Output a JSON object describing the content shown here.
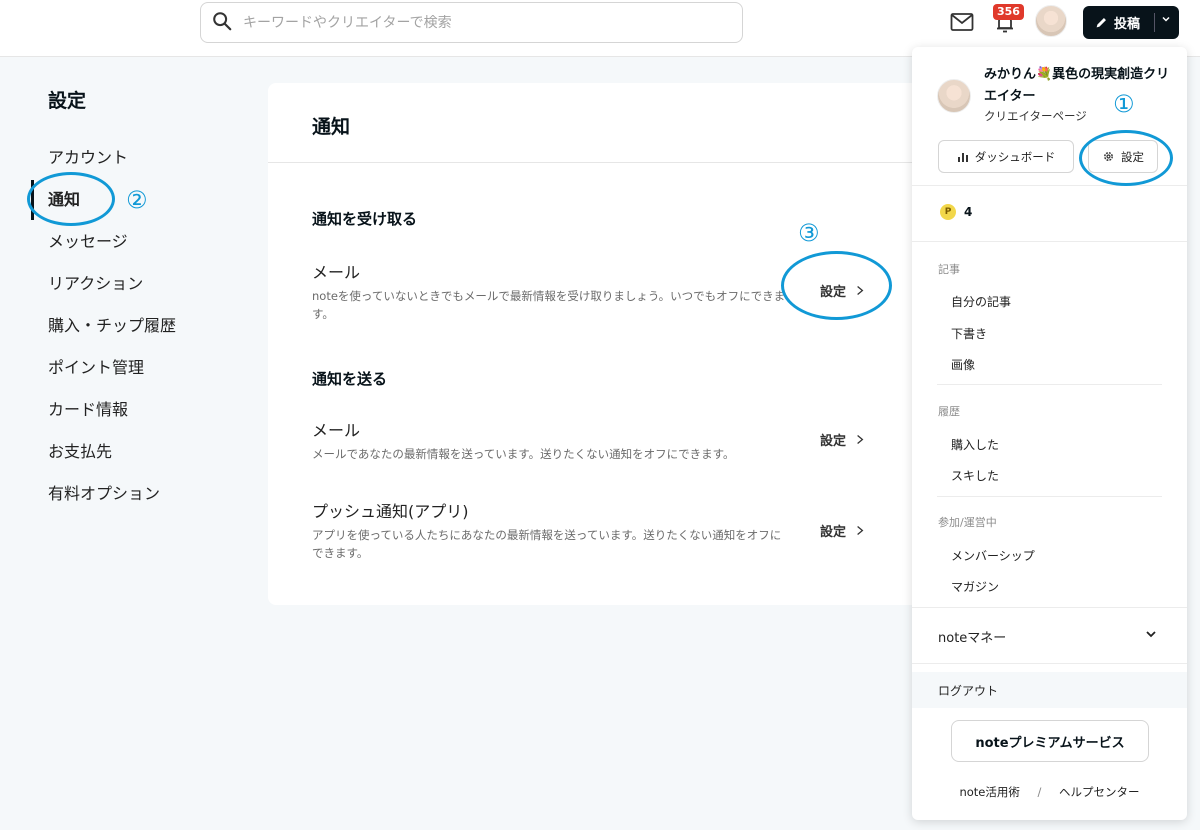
{
  "header": {
    "search_placeholder": "キーワードやクリエイターで検索",
    "notification_count": "356",
    "post_label": "投稿"
  },
  "sidebar": {
    "title": "設定",
    "items": [
      {
        "label": "アカウント"
      },
      {
        "label": "通知"
      },
      {
        "label": "メッセージ"
      },
      {
        "label": "リアクション"
      },
      {
        "label": "購入・チップ履歴"
      },
      {
        "label": "ポイント管理"
      },
      {
        "label": "カード情報"
      },
      {
        "label": "お支払先"
      },
      {
        "label": "有料オプション"
      }
    ]
  },
  "main": {
    "title": "通知",
    "receive": {
      "heading": "通知を受け取る",
      "mail_title": "メール",
      "mail_desc": "noteを使っていないときでもメールで最新情報を受け取りましょう。いつでもオフにできます。",
      "mail_link": "設定"
    },
    "send": {
      "heading": "通知を送る",
      "mail_title": "メール",
      "mail_desc": "メールであなたの最新情報を送っています。送りたくない通知をオフにできます。",
      "mail_link": "設定",
      "push_title": "プッシュ通知(アプリ)",
      "push_desc": "アプリを使っている人たちにあなたの最新情報を送っています。送りたくない通知をオフにできます。",
      "push_link": "設定"
    }
  },
  "dropdown": {
    "name": "みかりん💐異色の現実創造クリエイター",
    "sub": "クリエイターページ",
    "dashboard_label": "ダッシュボード",
    "settings_label": "設定",
    "points": "4",
    "points_icon": "P",
    "articles_heading": "記事",
    "articles": [
      "自分の記事",
      "下書き",
      "画像"
    ],
    "history_heading": "履歴",
    "history": [
      "購入した",
      "スキした"
    ],
    "joined_heading": "参加/運営中",
    "joined": [
      "メンバーシップ",
      "マガジン"
    ],
    "money_label": "noteマネー",
    "logout_label": "ログアウト",
    "premium_label": "noteプレミアムサービス",
    "footer_left": "note活用術",
    "footer_sep": "/",
    "footer_right": "ヘルプセンター"
  },
  "annotations": {
    "one": "①",
    "two": "②",
    "three": "③",
    "color": "#1199d6"
  }
}
